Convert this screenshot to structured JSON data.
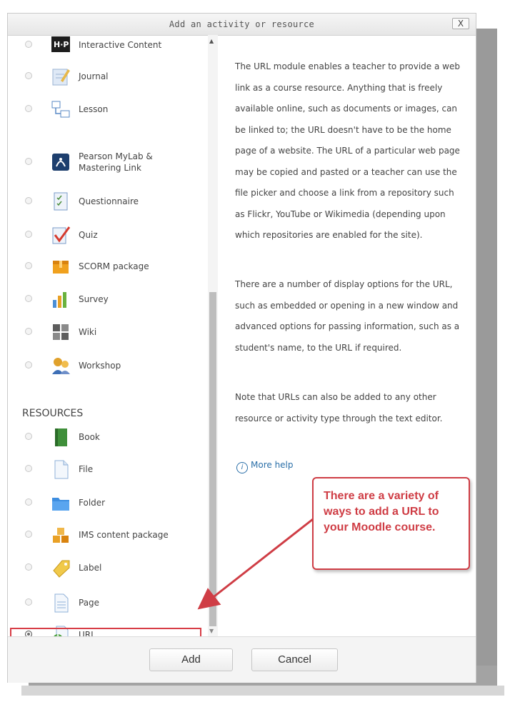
{
  "dialog": {
    "title": "Add an activity or resource",
    "close_label": "X"
  },
  "activities": [
    {
      "label": "Interactive Content",
      "icon": "hp-icon"
    },
    {
      "label": "Journal",
      "icon": "journal-icon"
    },
    {
      "label": "Lesson",
      "icon": "lesson-icon"
    },
    {
      "label_line1": "Pearson MyLab &",
      "label_line2": "Mastering Link",
      "icon": "pearson-icon"
    },
    {
      "label": "Questionnaire",
      "icon": "questionnaire-icon"
    },
    {
      "label": "Quiz",
      "icon": "quiz-icon"
    },
    {
      "label": "SCORM package",
      "icon": "scorm-icon"
    },
    {
      "label": "Survey",
      "icon": "survey-icon"
    },
    {
      "label": "Wiki",
      "icon": "wiki-icon"
    },
    {
      "label": "Workshop",
      "icon": "workshop-icon"
    }
  ],
  "resources_heading": "RESOURCES",
  "resources": [
    {
      "label": "Book",
      "icon": "book-icon"
    },
    {
      "label": "File",
      "icon": "file-icon"
    },
    {
      "label": "Folder",
      "icon": "folder-icon"
    },
    {
      "label": "IMS content package",
      "icon": "ims-icon"
    },
    {
      "label": "Label",
      "icon": "label-icon"
    },
    {
      "label": "Page",
      "icon": "page-icon"
    },
    {
      "label": "URL",
      "icon": "url-icon",
      "selected": true
    }
  ],
  "description": {
    "paragraph1": "The URL module enables a teacher to provide a web link as a course resource. Anything that is freely available online, such as documents or images, can be linked to; the URL doesn't have to be the home page of a website. The URL of a particular web page may be copied and pasted or a teacher can use the file picker and choose a link from a repository such as Flickr, YouTube or Wikimedia (depending upon which repositories are enabled for the site).",
    "paragraph2": "There are a number of display options for the URL, such as embedded or opening in a new window and advanced options for passing information, such as a student's name, to the URL if required.",
    "paragraph3": "Note that URLs can also be added to any other resource or activity type through the text editor.",
    "more_help": "More help"
  },
  "callout": {
    "text": "There are a variety of ways to add a URL to your Moodle course."
  },
  "footer": {
    "add_label": "Add",
    "cancel_label": "Cancel"
  },
  "colors": {
    "accent_red": "#cf3d45",
    "link_blue": "#2a6fa8"
  }
}
